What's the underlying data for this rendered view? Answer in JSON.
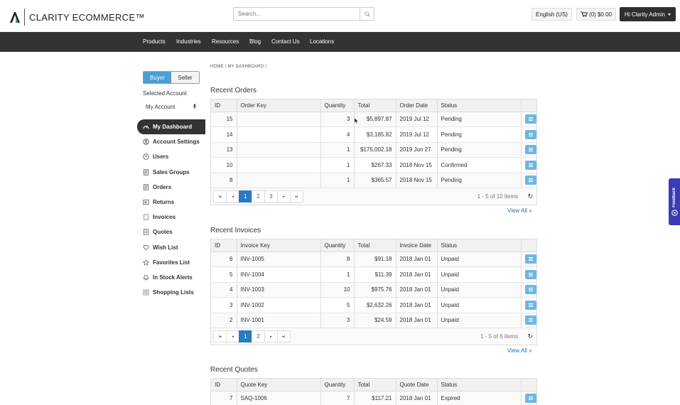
{
  "header": {
    "logo_text": "CLARITY ECOMMERCE™",
    "search_placeholder": "Search...",
    "language": "English (US)",
    "cart": "(0) $0.00",
    "user": "Hi Clarity Admin"
  },
  "nav": [
    "Products",
    "Industries",
    "Resources",
    "Blog",
    "Contact Us",
    "Locations"
  ],
  "sidebar": {
    "toggle": [
      "Buyer",
      "Seller"
    ],
    "selected_account_label": "Selected Account",
    "selected_account_value": "My Account",
    "items": [
      {
        "label": "My Dashboard",
        "icon": "dashboard-icon"
      },
      {
        "label": "Account Settings",
        "icon": "user-icon"
      },
      {
        "label": "Users",
        "icon": "users-icon"
      },
      {
        "label": "Sales Groups",
        "icon": "document-icon"
      },
      {
        "label": "Orders",
        "icon": "document-icon"
      },
      {
        "label": "Returns",
        "icon": "returns-icon"
      },
      {
        "label": "Invoices",
        "icon": "invoice-icon"
      },
      {
        "label": "Quotes",
        "icon": "quote-icon"
      },
      {
        "label": "Wish List",
        "icon": "heart-icon"
      },
      {
        "label": "Favorites List",
        "icon": "star-icon"
      },
      {
        "label": "In Stock Alerts",
        "icon": "bell-icon"
      },
      {
        "label": "Shopping Lists",
        "icon": "list-icon"
      }
    ]
  },
  "breadcrumb": "HOME / MY DASHBOARD /",
  "orders": {
    "title": "Recent Orders",
    "columns": [
      "ID",
      "Order Key",
      "Quantity",
      "Total",
      "Order Date",
      "Status"
    ],
    "rows": [
      [
        "15",
        "",
        "3",
        "$5,897.87",
        "2019 Jul 12",
        "Pending"
      ],
      [
        "14",
        "",
        "4",
        "$3,185.82",
        "2019 Jul 12",
        "Pending"
      ],
      [
        "13",
        "",
        "1",
        "$175,002.18",
        "2019 Jun 27",
        "Pending"
      ],
      [
        "10",
        "",
        "1",
        "$267.33",
        "2018 Nov 15",
        "Confirmed"
      ],
      [
        "8",
        "",
        "1",
        "$365.57",
        "2018 Nov 15",
        "Pending"
      ]
    ],
    "pages": [
      "1",
      "2",
      "3"
    ],
    "pager_info": "1 - 5 of 12 items",
    "view_all": "View All »"
  },
  "invoices": {
    "title": "Recent Invoices",
    "columns": [
      "ID",
      "Invoice Key",
      "Quantity",
      "Total",
      "Invoice Date",
      "Status"
    ],
    "rows": [
      [
        "6",
        "INV-1005",
        "8",
        "$91.18",
        "2018 Jan 01",
        "Unpaid"
      ],
      [
        "5",
        "INV-1004",
        "1",
        "$11.39",
        "2018 Jan 01",
        "Unpaid"
      ],
      [
        "4",
        "INV-1003",
        "10",
        "$975.76",
        "2018 Jan 01",
        "Unpaid"
      ],
      [
        "3",
        "INV-1002",
        "5",
        "$2,632.26",
        "2018 Jan 01",
        "Unpaid"
      ],
      [
        "2",
        "INV-1001",
        "3",
        "$24.59",
        "2018 Jan 01",
        "Unpaid"
      ]
    ],
    "pages": [
      "1",
      "2"
    ],
    "pager_info": "1 - 5 of 6 items",
    "view_all": "View All »"
  },
  "quotes": {
    "title": "Recent Quotes",
    "columns": [
      "ID",
      "Quote Key",
      "Quantity",
      "Total",
      "Quote Date",
      "Status"
    ],
    "rows": [
      [
        "7",
        "SAQ-1006",
        "7",
        "$117.21",
        "2018 Jan 01",
        "Expired"
      ]
    ]
  },
  "feedback": "Feedback",
  "colors": {
    "accent": "#2a7ac0",
    "nav_bg": "#333333",
    "action_btn": "#6bb7e6",
    "feedback_bg": "#3b3bb5"
  }
}
